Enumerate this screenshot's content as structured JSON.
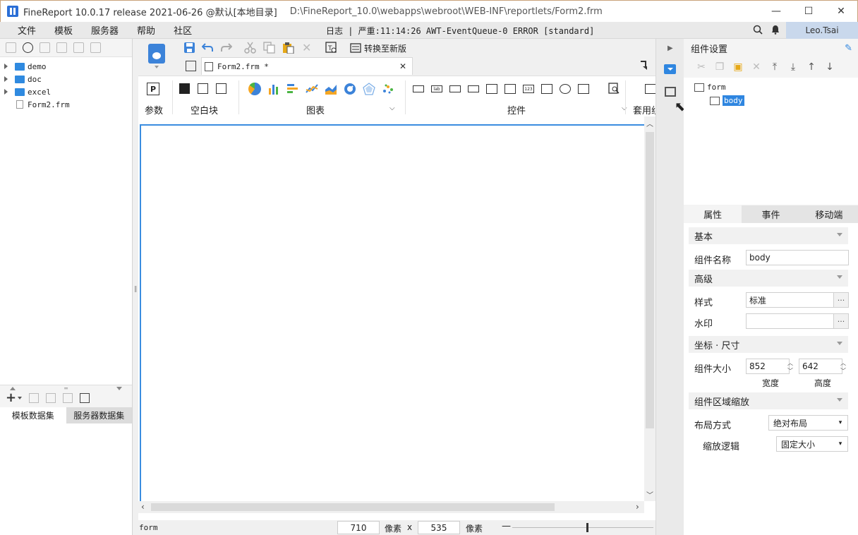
{
  "titlebar": {
    "title": "FineReport 10.0.17 release 2021-06-26 @默认[本地目录]",
    "path": "D:\\FineReport_10.0\\webapps\\webroot\\WEB-INF\\reportlets/Form2.frm",
    "minimize": "—",
    "maximize": "☐",
    "close": "✕"
  },
  "menubar": {
    "items": [
      "文件",
      "模板",
      "服务器",
      "帮助",
      "社区"
    ],
    "log_text": "日志 | 严重:11:14:26 AWT-EventQueue-0 ERROR [standard]",
    "user": "Leo.Tsai"
  },
  "filetree": {
    "items": [
      {
        "label": "demo",
        "type": "folder"
      },
      {
        "label": "doc",
        "type": "folder"
      },
      {
        "label": "excel",
        "type": "folder"
      },
      {
        "label": "Form2.frm",
        "type": "file"
      }
    ]
  },
  "dataset": {
    "tabs": [
      "模板数据集",
      "服务器数据集"
    ]
  },
  "toolbar": {
    "convert_label": "转换至新版"
  },
  "doc_tab": {
    "label": "Form2.frm *",
    "close": "✕"
  },
  "ribbon": {
    "groups": {
      "param": "参数",
      "blank": "空白块",
      "chart": "图表",
      "widget": "控件",
      "template": "套用组"
    }
  },
  "status": {
    "form_label": "form",
    "width_value": "710",
    "width_unit": "像素",
    "times": "x",
    "height_value": "535",
    "height_unit": "像素",
    "zoom_minus": "—"
  },
  "rightpanel": {
    "title": "组件设置",
    "tree": {
      "root": "form",
      "child": "body"
    },
    "tabs": [
      "属性",
      "事件",
      "移动端"
    ],
    "sections": {
      "basic": "基本",
      "advanced": "高级",
      "coords": "坐标 · 尺寸",
      "scale": "组件区域缩放"
    },
    "props": {
      "name_label": "组件名称",
      "name_value": "body",
      "style_label": "样式",
      "style_value": "标准",
      "watermark_label": "水印",
      "watermark_value": "",
      "size_label": "组件大小",
      "width_value": "852",
      "height_value": "642",
      "width_caption": "宽度",
      "height_caption": "高度",
      "layout_label": "布局方式",
      "layout_value": "绝对布局",
      "scale_label": "缩放逻辑",
      "scale_value": "固定大小",
      "dots": "···"
    }
  }
}
